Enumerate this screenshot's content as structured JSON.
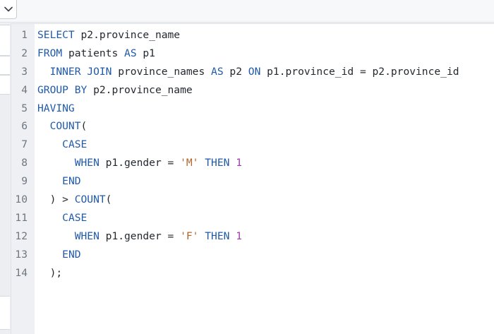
{
  "toolbar": {
    "dropdown_icon": "chevron-down-icon"
  },
  "editor": {
    "language": "SQL",
    "lines": [
      {
        "number": "1",
        "tokens": [
          {
            "t": "kw",
            "v": "SELECT"
          },
          {
            "t": "plain",
            "v": " p2.province_name"
          }
        ]
      },
      {
        "number": "2",
        "tokens": [
          {
            "t": "kw",
            "v": "FROM"
          },
          {
            "t": "plain",
            "v": " patients "
          },
          {
            "t": "kw",
            "v": "AS"
          },
          {
            "t": "plain",
            "v": " p1"
          }
        ]
      },
      {
        "number": "3",
        "tokens": [
          {
            "t": "plain",
            "v": "  "
          },
          {
            "t": "kw",
            "v": "INNER JOIN"
          },
          {
            "t": "plain",
            "v": " province_names "
          },
          {
            "t": "kw",
            "v": "AS"
          },
          {
            "t": "plain",
            "v": " p2 "
          },
          {
            "t": "kw",
            "v": "ON"
          },
          {
            "t": "plain",
            "v": " p1.province_id = p2.province_id"
          }
        ]
      },
      {
        "number": "4",
        "tokens": [
          {
            "t": "kw",
            "v": "GROUP BY"
          },
          {
            "t": "plain",
            "v": " p2.province_name"
          }
        ]
      },
      {
        "number": "5",
        "tokens": [
          {
            "t": "kw",
            "v": "HAVING"
          }
        ]
      },
      {
        "number": "6",
        "tokens": [
          {
            "t": "plain",
            "v": "  "
          },
          {
            "t": "kw",
            "v": "COUNT"
          },
          {
            "t": "plain",
            "v": "("
          }
        ]
      },
      {
        "number": "7",
        "tokens": [
          {
            "t": "plain",
            "v": "    "
          },
          {
            "t": "kw",
            "v": "CASE"
          }
        ]
      },
      {
        "number": "8",
        "tokens": [
          {
            "t": "plain",
            "v": "      "
          },
          {
            "t": "kw",
            "v": "WHEN"
          },
          {
            "t": "plain",
            "v": " p1.gender = "
          },
          {
            "t": "str",
            "v": "'M'"
          },
          {
            "t": "plain",
            "v": " "
          },
          {
            "t": "kw",
            "v": "THEN"
          },
          {
            "t": "plain",
            "v": " "
          },
          {
            "t": "num",
            "v": "1"
          }
        ]
      },
      {
        "number": "9",
        "tokens": [
          {
            "t": "plain",
            "v": "    "
          },
          {
            "t": "kw",
            "v": "END"
          }
        ]
      },
      {
        "number": "10",
        "tokens": [
          {
            "t": "plain",
            "v": "  ) > "
          },
          {
            "t": "kw",
            "v": "COUNT"
          },
          {
            "t": "plain",
            "v": "("
          }
        ]
      },
      {
        "number": "11",
        "tokens": [
          {
            "t": "plain",
            "v": "    "
          },
          {
            "t": "kw",
            "v": "CASE"
          }
        ]
      },
      {
        "number": "12",
        "tokens": [
          {
            "t": "plain",
            "v": "      "
          },
          {
            "t": "kw",
            "v": "WHEN"
          },
          {
            "t": "plain",
            "v": " p1.gender = "
          },
          {
            "t": "str",
            "v": "'F'"
          },
          {
            "t": "plain",
            "v": " "
          },
          {
            "t": "kw",
            "v": "THEN"
          },
          {
            "t": "plain",
            "v": " "
          },
          {
            "t": "num",
            "v": "1"
          }
        ]
      },
      {
        "number": "13",
        "tokens": [
          {
            "t": "plain",
            "v": "    "
          },
          {
            "t": "kw",
            "v": "END"
          }
        ]
      },
      {
        "number": "14",
        "tokens": [
          {
            "t": "plain",
            "v": "  );"
          }
        ]
      }
    ]
  },
  "colors": {
    "keyword": "#1f5aa8",
    "string": "#b0662a",
    "number": "#a13aa8",
    "text": "#24292f",
    "gutter_bg": "#eef0f3",
    "line_number": "#6e7781"
  }
}
